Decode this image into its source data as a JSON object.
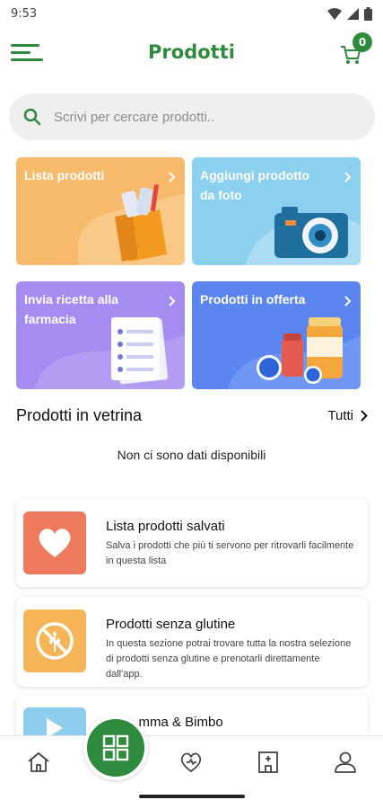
{
  "status_bar": {
    "time": "9:53",
    "icons": [
      "wifi-icon",
      "signal-icon",
      "battery-icon"
    ]
  },
  "header": {
    "title": "Prodotti",
    "menu_icon": "hamburger-menu-icon",
    "cart_icon": "shopping-cart-icon",
    "cart_count": "0"
  },
  "search": {
    "placeholder": "Scrivi per cercare prodotti..",
    "icon": "search-icon"
  },
  "tiles": [
    {
      "label": "Lista prodotti",
      "color": "#f7b96a",
      "icon": "shopping-bag-illustration"
    },
    {
      "label": "Aggiungi prodotto da foto",
      "color": "#8cd0ef",
      "icon": "camera-illustration"
    },
    {
      "label": "Invia ricetta alla farmacia",
      "color": "#a58cf0",
      "icon": "prescription-illustration"
    },
    {
      "label": "Prodotti in offerta",
      "color": "#5b86f0",
      "icon": "offer-bottles-illustration"
    }
  ],
  "showcase": {
    "title": "Prodotti in vetrina",
    "see_all": "Tutti",
    "empty": "Non ci sono dati disponibili"
  },
  "lists": [
    {
      "title": "Lista prodotti salvati",
      "description": "Salva i prodotti che più ti servono per ritrovarli facilmente in questa lista",
      "color": "#ef7b5f",
      "icon": "heart-icon"
    },
    {
      "title": "Prodotti senza glutine",
      "description": "In questa sezione potrai trovare tutta la nostra selezione di prodotti senza glutine e prenotarli direttamente dall'app.",
      "color": "#f6b556",
      "icon": "gluten-free-icon"
    },
    {
      "title": "...mma & Bimbo",
      "color": "#8ecdee",
      "icon": "baby-icon"
    }
  ],
  "bottom_nav": {
    "items": [
      "home-icon",
      "categories-icon",
      "health-icon",
      "pharmacy-icon",
      "profile-icon"
    ],
    "active_color": "#2e8b3d"
  },
  "colors": {
    "accent": "#2e8b3d"
  }
}
